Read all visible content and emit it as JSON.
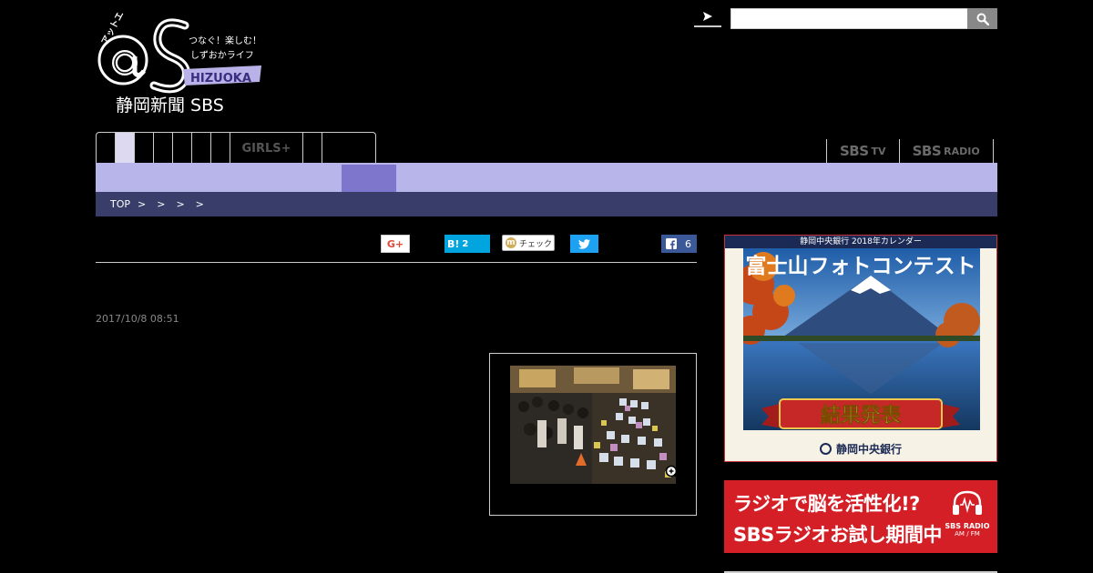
{
  "logo": {
    "kana": "アットエス",
    "tagline_1": "つなぐ！楽しむ！",
    "tagline_2": "しずおかライフ",
    "region": "HIZUOKA",
    "publisher": "静岡新聞 SBS"
  },
  "search": {
    "placeholder": "",
    "value": ""
  },
  "nav": {
    "tabs": [
      "",
      "",
      "",
      "",
      "",
      "",
      "",
      "GIRLS+",
      "",
      ""
    ],
    "active_index": 1
  },
  "brands": [
    {
      "main": "SBS",
      "suffix": "TV"
    },
    {
      "main": "SBS",
      "suffix": "RADIO"
    }
  ],
  "breadcrumb": [
    "TOP",
    ">",
    ">",
    ">",
    ">"
  ],
  "share": {
    "gplus": "G+",
    "hatena": "B!",
    "hatena_count": "2",
    "mixi": "m",
    "mixi_label": "チェック",
    "facebook_count": "6"
  },
  "article": {
    "date": "2017/10/8 08:51"
  },
  "ads": {
    "calendar": {
      "header": "静岡中央銀行 2018年カレンダー",
      "title": "富士山フォトコンテスト",
      "ribbon": "結果発表",
      "bank": "静岡中央銀行"
    },
    "radio": {
      "line1": "ラジオで脳を活性化!?",
      "line2": "SBSラジオお試し期間中",
      "badge": "SBS RADIO",
      "badge_sub": "AM / FM"
    }
  },
  "colors": {
    "subnav": "#b8b5eb",
    "subnav_active": "#7e76cc",
    "breadcrumb_bg": "#383e69",
    "hatena": "#00a4de",
    "twitter": "#1da1f2",
    "facebook": "#3b5998",
    "radio_ad": "#d41f26"
  }
}
